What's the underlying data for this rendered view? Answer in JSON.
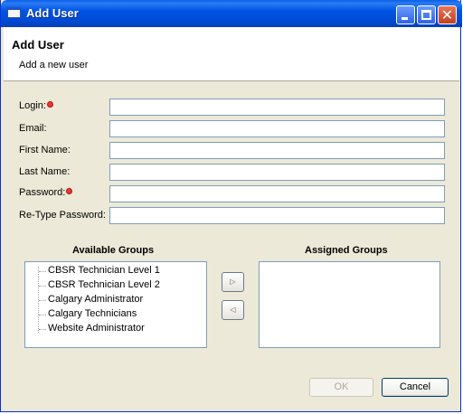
{
  "window": {
    "title": "Add User",
    "controls": {
      "minimize": "minimize-icon",
      "maximize": "maximize-icon",
      "close": "close-icon"
    }
  },
  "header": {
    "title": "Add User",
    "description": "Add a new user"
  },
  "form": {
    "fields": [
      {
        "label": "Login:",
        "value": "",
        "required": true
      },
      {
        "label": "Email:",
        "value": "",
        "required": false
      },
      {
        "label": "First Name:",
        "value": "",
        "required": false
      },
      {
        "label": "Last Name:",
        "value": "",
        "required": false
      },
      {
        "label": "Password:",
        "value": "",
        "required": true
      },
      {
        "label": "Re-Type Password:",
        "value": "",
        "required": false
      }
    ]
  },
  "groups": {
    "available_heading": "Available Groups",
    "assigned_heading": "Assigned Groups",
    "available": [
      "CBSR Technician Level 1",
      "CBSR Technician Level 2",
      "Calgary Administrator",
      "Calgary Technicians",
      "Website Administrator"
    ],
    "assigned": [],
    "move_right_icon": "arrow-right-icon",
    "move_left_icon": "arrow-left-icon"
  },
  "buttons": {
    "ok": "OK",
    "cancel": "Cancel"
  },
  "colors": {
    "titlebar": "#0054e3",
    "dialog_bg": "#ece9d8",
    "required_marker": "#e33a3a",
    "input_border": "#7f9db9"
  }
}
